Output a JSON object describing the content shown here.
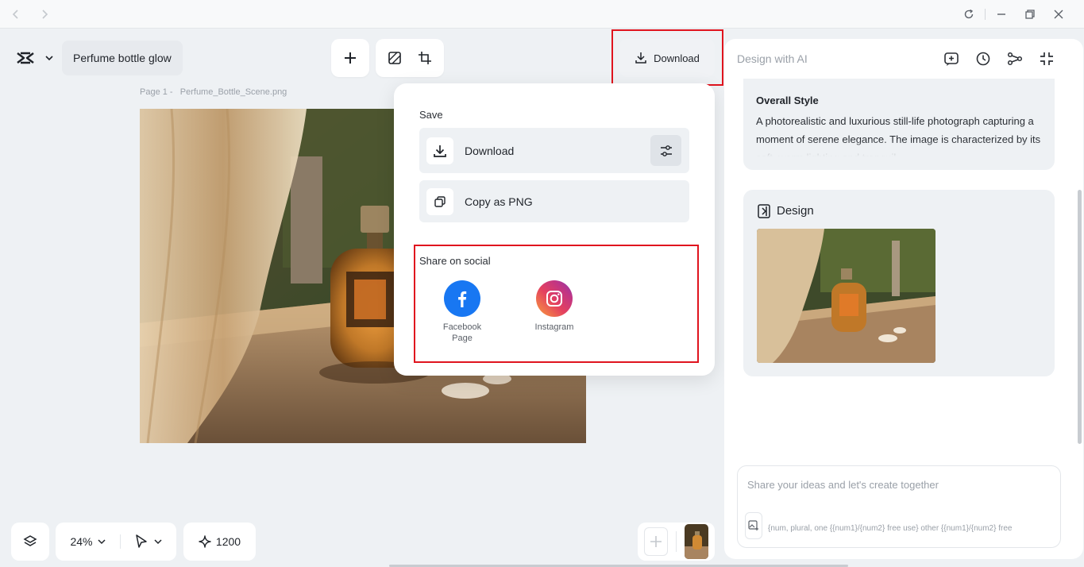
{
  "window": {
    "nav": [
      "back-icon",
      "forward-icon"
    ],
    "controls": [
      "refresh-icon",
      "minimize-icon",
      "restore-icon",
      "close-icon"
    ]
  },
  "project": {
    "title": "Perfume bottle glow"
  },
  "canvas": {
    "page_label": "Page 1 -",
    "file_name": "Perfume_Bottle_Scene.png"
  },
  "toolbar": {
    "download_label": "Download",
    "tools": [
      "add-icon",
      "remove-background-icon",
      "resize-icon"
    ]
  },
  "download_menu": {
    "save_heading": "Save",
    "download_label": "Download",
    "copy_label": "Copy as PNG",
    "share_heading": "Share on social",
    "social": [
      {
        "label_line1": "Facebook",
        "label_line2": "Page",
        "color": "#1877f2"
      },
      {
        "label_line1": "Instagram",
        "label_line2": "",
        "color": "#e4405f"
      }
    ]
  },
  "ai_panel": {
    "title": "Design with AI",
    "style_heading": "Overall Style",
    "style_text": "A photorealistic and luxurious still-life photograph capturing a moment of serene elegance. The image is characterized by its soft, warm lighting and tranquil",
    "design_heading": "Design",
    "input_placeholder": "Share your ideas and let's create together",
    "quota_text": "{num, plural, one {{num1}/{num2} free use} other {{num1}/{num2} free"
  },
  "bottom": {
    "zoom": "24%",
    "credits": "1200"
  },
  "colors": {
    "accent_red": "#e0141e",
    "facebook": "#1877f2"
  }
}
